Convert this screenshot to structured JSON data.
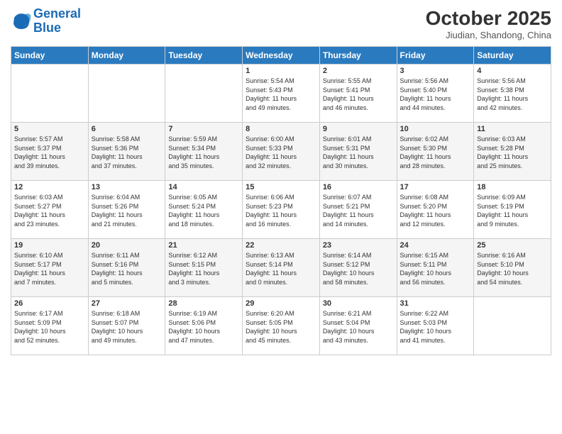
{
  "header": {
    "logo_line1": "General",
    "logo_line2": "Blue",
    "month": "October 2025",
    "location": "Jiudian, Shandong, China"
  },
  "days_of_week": [
    "Sunday",
    "Monday",
    "Tuesday",
    "Wednesday",
    "Thursday",
    "Friday",
    "Saturday"
  ],
  "weeks": [
    [
      {
        "day": "",
        "info": ""
      },
      {
        "day": "",
        "info": ""
      },
      {
        "day": "",
        "info": ""
      },
      {
        "day": "1",
        "info": "Sunrise: 5:54 AM\nSunset: 5:43 PM\nDaylight: 11 hours\nand 49 minutes."
      },
      {
        "day": "2",
        "info": "Sunrise: 5:55 AM\nSunset: 5:41 PM\nDaylight: 11 hours\nand 46 minutes."
      },
      {
        "day": "3",
        "info": "Sunrise: 5:56 AM\nSunset: 5:40 PM\nDaylight: 11 hours\nand 44 minutes."
      },
      {
        "day": "4",
        "info": "Sunrise: 5:56 AM\nSunset: 5:38 PM\nDaylight: 11 hours\nand 42 minutes."
      }
    ],
    [
      {
        "day": "5",
        "info": "Sunrise: 5:57 AM\nSunset: 5:37 PM\nDaylight: 11 hours\nand 39 minutes."
      },
      {
        "day": "6",
        "info": "Sunrise: 5:58 AM\nSunset: 5:36 PM\nDaylight: 11 hours\nand 37 minutes."
      },
      {
        "day": "7",
        "info": "Sunrise: 5:59 AM\nSunset: 5:34 PM\nDaylight: 11 hours\nand 35 minutes."
      },
      {
        "day": "8",
        "info": "Sunrise: 6:00 AM\nSunset: 5:33 PM\nDaylight: 11 hours\nand 32 minutes."
      },
      {
        "day": "9",
        "info": "Sunrise: 6:01 AM\nSunset: 5:31 PM\nDaylight: 11 hours\nand 30 minutes."
      },
      {
        "day": "10",
        "info": "Sunrise: 6:02 AM\nSunset: 5:30 PM\nDaylight: 11 hours\nand 28 minutes."
      },
      {
        "day": "11",
        "info": "Sunrise: 6:03 AM\nSunset: 5:28 PM\nDaylight: 11 hours\nand 25 minutes."
      }
    ],
    [
      {
        "day": "12",
        "info": "Sunrise: 6:03 AM\nSunset: 5:27 PM\nDaylight: 11 hours\nand 23 minutes."
      },
      {
        "day": "13",
        "info": "Sunrise: 6:04 AM\nSunset: 5:26 PM\nDaylight: 11 hours\nand 21 minutes."
      },
      {
        "day": "14",
        "info": "Sunrise: 6:05 AM\nSunset: 5:24 PM\nDaylight: 11 hours\nand 18 minutes."
      },
      {
        "day": "15",
        "info": "Sunrise: 6:06 AM\nSunset: 5:23 PM\nDaylight: 11 hours\nand 16 minutes."
      },
      {
        "day": "16",
        "info": "Sunrise: 6:07 AM\nSunset: 5:21 PM\nDaylight: 11 hours\nand 14 minutes."
      },
      {
        "day": "17",
        "info": "Sunrise: 6:08 AM\nSunset: 5:20 PM\nDaylight: 11 hours\nand 12 minutes."
      },
      {
        "day": "18",
        "info": "Sunrise: 6:09 AM\nSunset: 5:19 PM\nDaylight: 11 hours\nand 9 minutes."
      }
    ],
    [
      {
        "day": "19",
        "info": "Sunrise: 6:10 AM\nSunset: 5:17 PM\nDaylight: 11 hours\nand 7 minutes."
      },
      {
        "day": "20",
        "info": "Sunrise: 6:11 AM\nSunset: 5:16 PM\nDaylight: 11 hours\nand 5 minutes."
      },
      {
        "day": "21",
        "info": "Sunrise: 6:12 AM\nSunset: 5:15 PM\nDaylight: 11 hours\nand 3 minutes."
      },
      {
        "day": "22",
        "info": "Sunrise: 6:13 AM\nSunset: 5:14 PM\nDaylight: 11 hours\nand 0 minutes."
      },
      {
        "day": "23",
        "info": "Sunrise: 6:14 AM\nSunset: 5:12 PM\nDaylight: 10 hours\nand 58 minutes."
      },
      {
        "day": "24",
        "info": "Sunrise: 6:15 AM\nSunset: 5:11 PM\nDaylight: 10 hours\nand 56 minutes."
      },
      {
        "day": "25",
        "info": "Sunrise: 6:16 AM\nSunset: 5:10 PM\nDaylight: 10 hours\nand 54 minutes."
      }
    ],
    [
      {
        "day": "26",
        "info": "Sunrise: 6:17 AM\nSunset: 5:09 PM\nDaylight: 10 hours\nand 52 minutes."
      },
      {
        "day": "27",
        "info": "Sunrise: 6:18 AM\nSunset: 5:07 PM\nDaylight: 10 hours\nand 49 minutes."
      },
      {
        "day": "28",
        "info": "Sunrise: 6:19 AM\nSunset: 5:06 PM\nDaylight: 10 hours\nand 47 minutes."
      },
      {
        "day": "29",
        "info": "Sunrise: 6:20 AM\nSunset: 5:05 PM\nDaylight: 10 hours\nand 45 minutes."
      },
      {
        "day": "30",
        "info": "Sunrise: 6:21 AM\nSunset: 5:04 PM\nDaylight: 10 hours\nand 43 minutes."
      },
      {
        "day": "31",
        "info": "Sunrise: 6:22 AM\nSunset: 5:03 PM\nDaylight: 10 hours\nand 41 minutes."
      },
      {
        "day": "",
        "info": ""
      }
    ]
  ]
}
